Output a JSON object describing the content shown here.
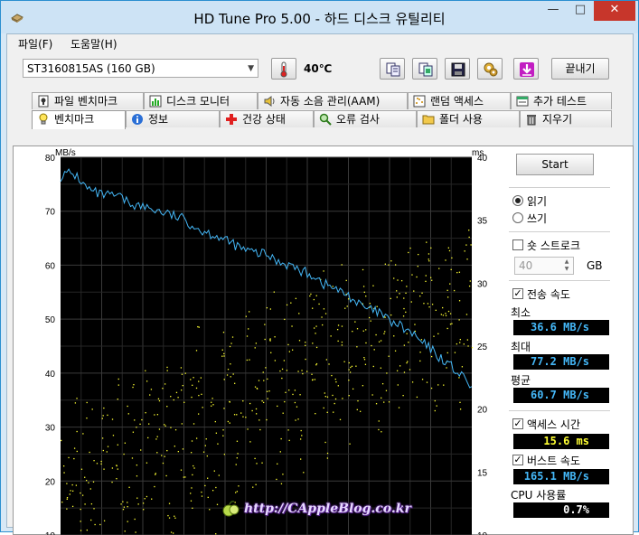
{
  "window": {
    "title": "HD Tune Pro 5.00 - 하드 디스크 유틸리티"
  },
  "menu": [
    "파일(F)",
    "도움말(H)"
  ],
  "toolbar": {
    "drive": "ST3160815AS (160 GB)",
    "temperature": "40℃",
    "exit_label": "끝내기",
    "buttons": [
      "copy-text-icon",
      "copy-screenshot-icon",
      "save-icon",
      "settings-icon",
      "download-icon"
    ]
  },
  "tabs_row1": [
    {
      "label": "파일 벤치마크",
      "icon": "file-benchmark-icon"
    },
    {
      "label": "디스크 모니터",
      "icon": "disk-monitor-icon"
    },
    {
      "label": "자동 소음 관리(AAM)",
      "icon": "speaker-icon"
    },
    {
      "label": "랜덤 액세스",
      "icon": "random-access-icon"
    },
    {
      "label": "추가 테스트",
      "icon": "extra-tests-icon"
    }
  ],
  "tabs_row2": [
    {
      "label": "벤치마크",
      "icon": "lightbulb-icon"
    },
    {
      "label": "정보",
      "icon": "info-icon"
    },
    {
      "label": "건강 상태",
      "icon": "health-cross-icon"
    },
    {
      "label": "오류 검사",
      "icon": "magnifier-icon"
    },
    {
      "label": "폴더 사용",
      "icon": "folder-icon"
    },
    {
      "label": "지우기",
      "icon": "trash-icon"
    }
  ],
  "side": {
    "start_label": "Start",
    "read_label": "읽기",
    "write_label": "쓰기",
    "read_selected": true,
    "short_stroke_label": "숏 스트로크",
    "short_stroke_checked": false,
    "short_stroke_value": "40",
    "short_stroke_unit": "GB",
    "transfer_label": "전송 속도",
    "transfer_checked": true,
    "min_label": "최소",
    "min_value": "36.6 MB/s",
    "max_label": "최대",
    "max_value": "77.2 MB/s",
    "avg_label": "평균",
    "avg_value": "60.7 MB/s",
    "access_label": "액세스 시간",
    "access_checked": true,
    "access_value": "15.6 ms",
    "burst_label": "버스트 속도",
    "burst_checked": true,
    "burst_value": "165.1 MB/s",
    "cpu_label": "CPU 사용률",
    "cpu_value": "0.7%",
    "colors": {
      "transfer": "#44b7f7",
      "access": "#ffff33",
      "stat_text": "#ffffff"
    }
  },
  "chart_data": {
    "type": "line",
    "left_unit": "MB/s",
    "right_unit": "ms",
    "left_ticks": [
      "80",
      "70",
      "60",
      "50",
      "40",
      "30",
      "20",
      "10"
    ],
    "right_ticks": [
      "40",
      "35",
      "30",
      "25",
      "20",
      "15",
      "10"
    ],
    "ylim_left": [
      10,
      80
    ],
    "ylim_right": [
      10,
      40
    ],
    "xlim": [
      0,
      100
    ],
    "grid": true,
    "background": "#000000",
    "series": [
      {
        "color": "#44b7f7",
        "x": [
          0,
          2,
          4,
          6,
          8,
          10,
          12,
          14,
          16,
          18,
          20,
          22,
          24,
          26,
          28,
          30,
          32,
          34,
          36,
          38,
          40,
          42,
          44,
          46,
          48,
          50,
          52,
          54,
          56,
          58,
          60,
          62,
          64,
          66,
          68,
          70,
          72,
          74,
          76,
          78,
          80,
          82,
          84,
          86,
          88,
          90,
          92,
          94,
          96,
          98,
          100
        ],
        "y": [
          76.5,
          77.0,
          76.5,
          74.5,
          73.5,
          73.0,
          72.8,
          72.8,
          71.8,
          71.2,
          70.8,
          70.5,
          70.0,
          69.5,
          69.0,
          68.5,
          67.5,
          66.5,
          66.0,
          65.5,
          64.5,
          64.0,
          63.0,
          62.5,
          62.2,
          62.0,
          61.0,
          60.5,
          60.0,
          59.0,
          58.5,
          58.0,
          56.5,
          56.0,
          55.0,
          54.5,
          53.0,
          52.0,
          51.5,
          51.0,
          49.5,
          49.0,
          48.0,
          47.0,
          45.5,
          44.5,
          43.0,
          42.0,
          40.5,
          39.0,
          37.5
        ]
      }
    ],
    "scatter": {
      "color": "#ffff33",
      "description_points": [
        [
          1,
          12.5
        ],
        [
          3,
          16.0
        ],
        [
          5,
          13.0
        ],
        [
          7,
          15.5
        ],
        [
          9,
          11.0
        ],
        [
          11,
          14.5
        ],
        [
          13,
          16.5
        ],
        [
          15,
          12.0
        ],
        [
          17,
          17.0
        ],
        [
          19,
          13.5
        ],
        [
          21,
          18.0
        ],
        [
          23,
          15.0
        ],
        [
          25,
          19.5
        ],
        [
          27,
          16.0
        ],
        [
          29,
          20.0
        ],
        [
          31,
          17.5
        ],
        [
          33,
          21.0
        ],
        [
          35,
          18.5
        ],
        [
          37,
          16.0
        ],
        [
          39,
          20.5
        ],
        [
          41,
          22.0
        ],
        [
          43,
          18.0
        ],
        [
          45,
          23.0
        ],
        [
          47,
          19.5
        ],
        [
          49,
          21.5
        ],
        [
          51,
          24.0
        ],
        [
          53,
          20.0
        ],
        [
          55,
          22.5
        ],
        [
          57,
          25.0
        ],
        [
          59,
          21.0
        ],
        [
          61,
          23.5
        ],
        [
          63,
          26.0
        ],
        [
          65,
          22.0
        ],
        [
          67,
          24.5
        ],
        [
          69,
          26.5
        ],
        [
          71,
          23.0
        ],
        [
          73,
          25.5
        ],
        [
          75,
          27.0
        ],
        [
          77,
          24.0
        ],
        [
          79,
          26.0
        ],
        [
          81,
          27.5
        ],
        [
          83,
          25.0
        ],
        [
          85,
          27.0
        ],
        [
          87,
          26.5
        ],
        [
          89,
          28.0
        ],
        [
          91,
          25.5
        ],
        [
          93,
          27.5
        ],
        [
          95,
          29.0
        ],
        [
          97,
          26.0
        ],
        [
          99,
          28.5
        ]
      ]
    }
  },
  "watermark": "http://CAppleBlog.co.kr"
}
